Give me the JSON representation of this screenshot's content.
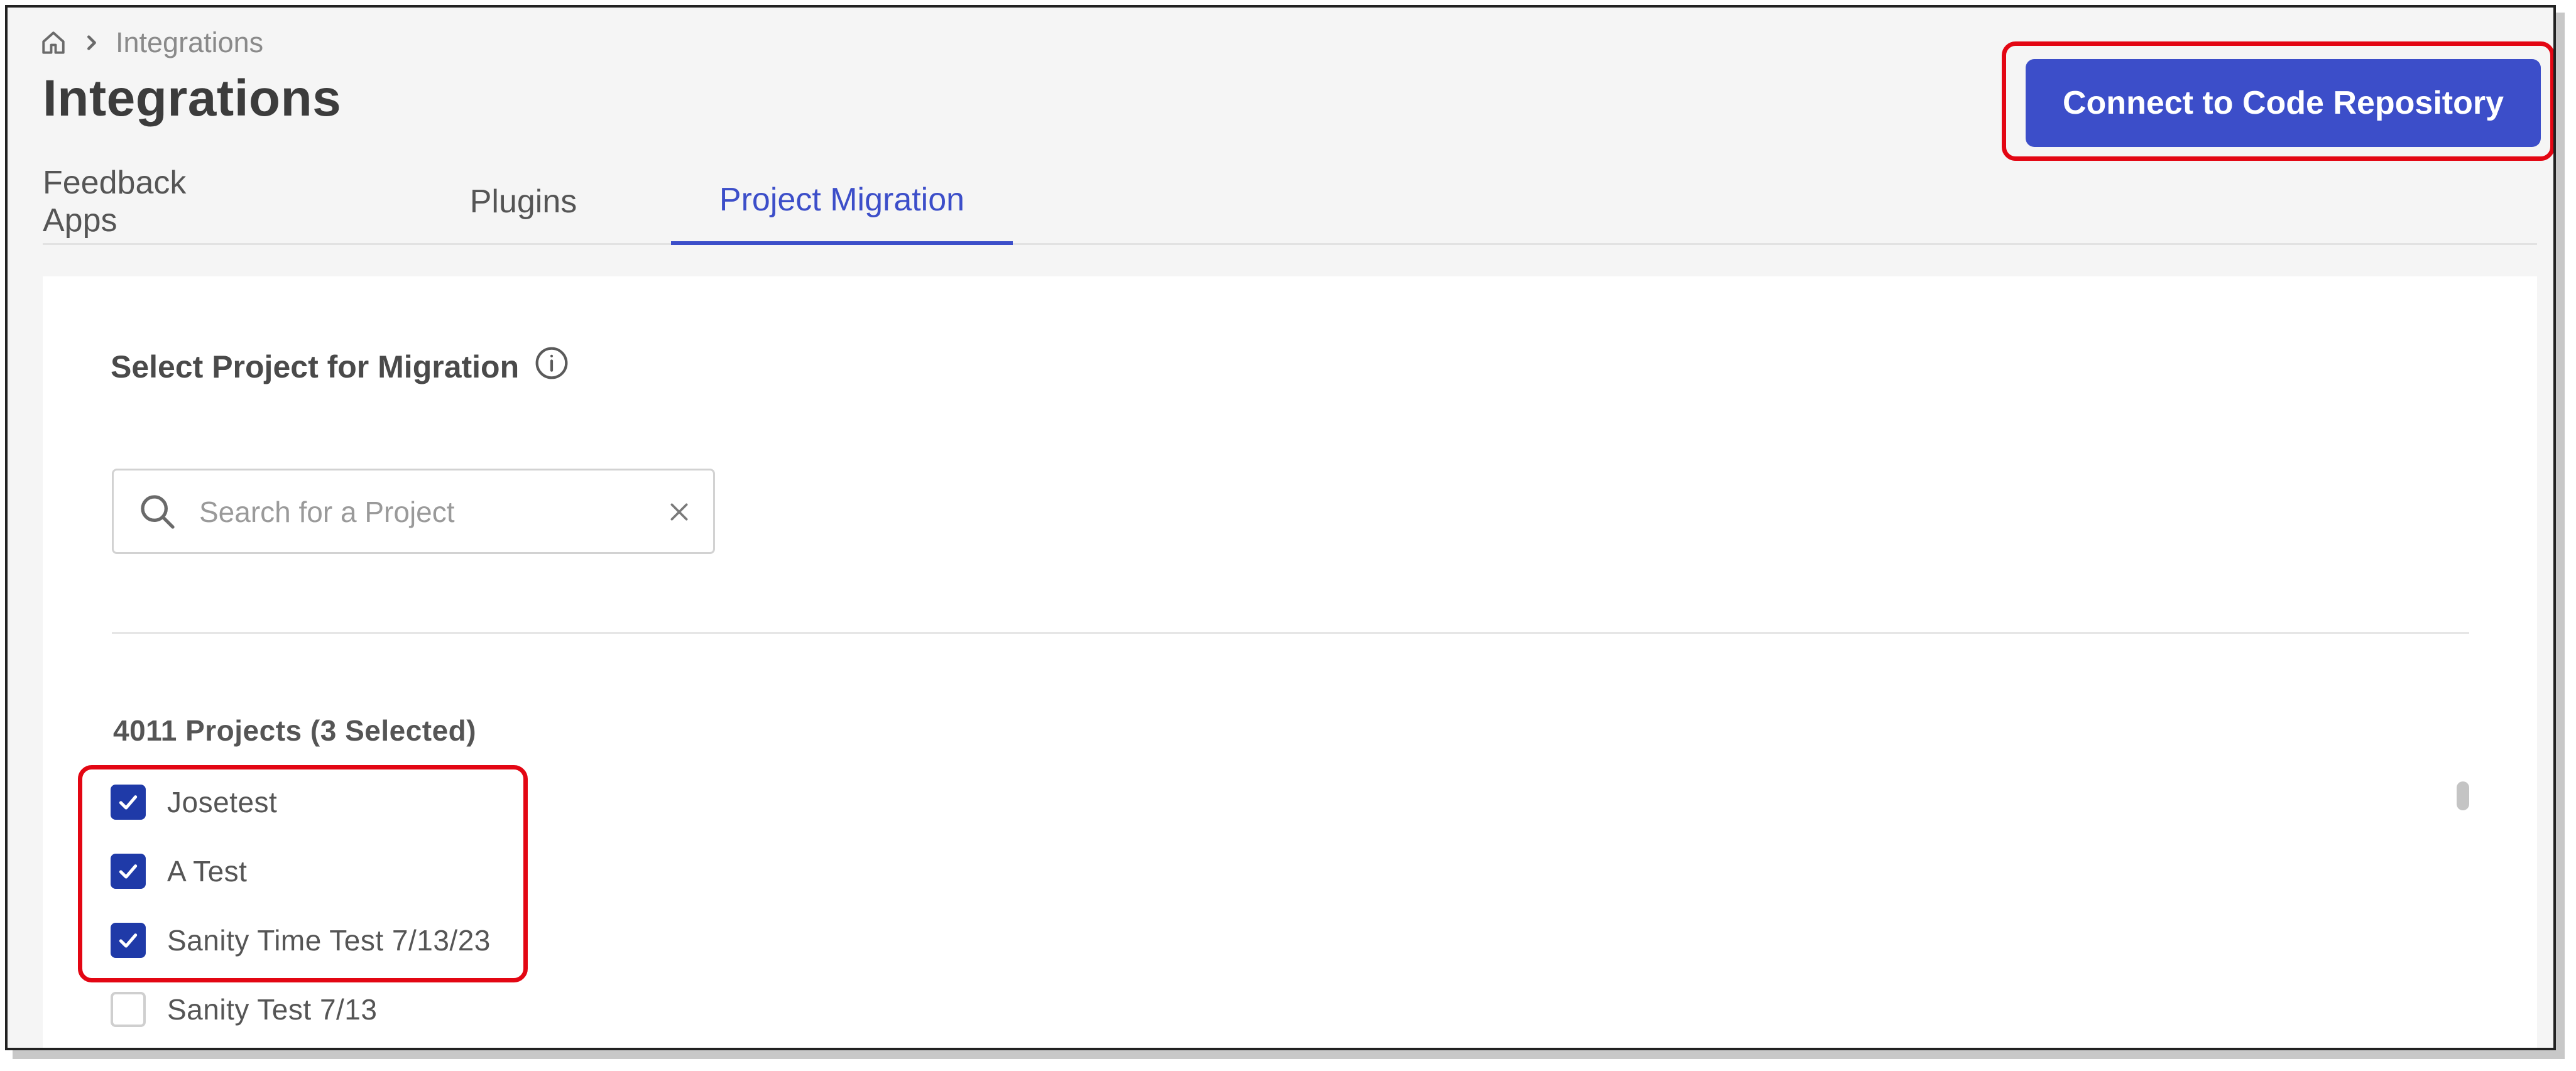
{
  "breadcrumb": {
    "home_icon": "home-icon",
    "separator_icon": "chevron-right-icon",
    "current": "Integrations"
  },
  "page_title": "Integrations",
  "header": {
    "connect_button_label": "Connect to Code Repository"
  },
  "tabs": [
    {
      "label": "Feedback Apps",
      "active": false
    },
    {
      "label": "Plugins",
      "active": false
    },
    {
      "label": "Project Migration",
      "active": true
    }
  ],
  "migration": {
    "section_title": "Select Project for Migration",
    "info_icon": "info-icon",
    "search": {
      "placeholder": "Search for a Project",
      "value": "",
      "icon": "search-icon",
      "clear_icon": "close-icon"
    },
    "count_label": "4011 Projects (3 Selected)",
    "projects": [
      {
        "name": "Josetest",
        "checked": true
      },
      {
        "name": "A Test",
        "checked": true
      },
      {
        "name": "Sanity Time Test 7/13/23",
        "checked": true
      },
      {
        "name": "Sanity Test 7/13",
        "checked": false
      }
    ]
  },
  "colors": {
    "accent": "#3c4ec9",
    "checkbox_checked": "#1f3aa8",
    "highlight": "#e30613",
    "page_background": "#f5f5f5"
  }
}
